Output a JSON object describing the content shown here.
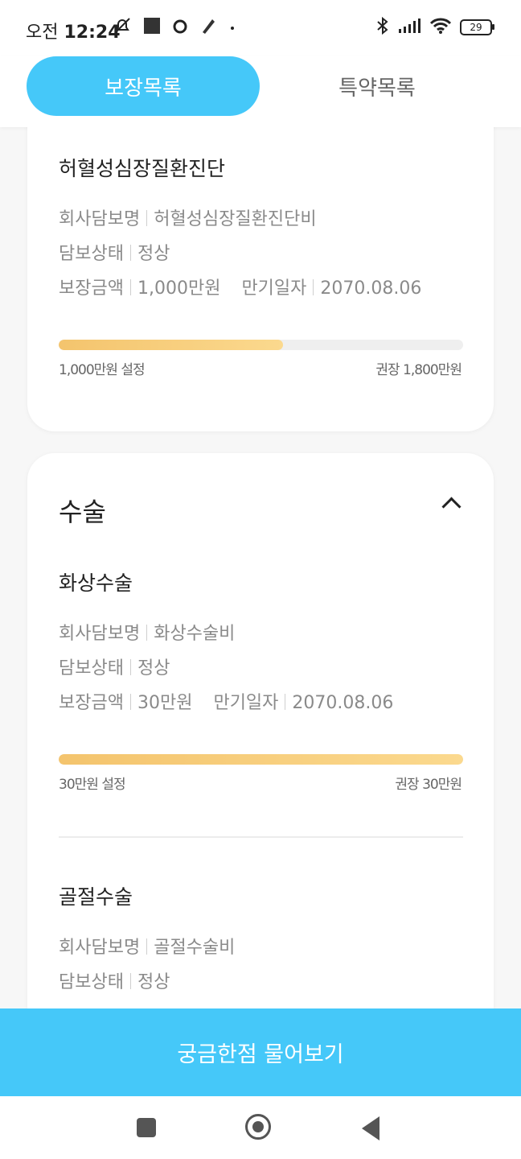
{
  "status_bar": {
    "time_prefix": "오전",
    "time": "12:24",
    "battery": "29",
    "icons_left": [
      "mute-icon",
      "square-icon",
      "circle-icon",
      "pen-icon",
      "dot-icon"
    ],
    "icons_right": [
      "bluetooth-icon",
      "signal-icon",
      "wifi-icon",
      "battery-icon"
    ]
  },
  "tabs": [
    {
      "label": "보장목록",
      "active": true
    },
    {
      "label": "특약목록",
      "active": false
    }
  ],
  "colors": {
    "accent": "#45c8f9",
    "bar_start": "#f4c46d",
    "bar_end": "#fbd98e"
  },
  "coverages": [
    {
      "title": "허혈성심장질환진단",
      "company_label": "회사담보명",
      "company_value": "허혈성심장질환진단비",
      "status_label": "담보상태",
      "status_value": "정상",
      "amount_label": "보장금액",
      "amount_value": "1,000만원",
      "expiry_label": "만기일자",
      "expiry_value": "2070.08.06",
      "bar_left": "1,000만원 설정",
      "bar_right": "권장 1,800만원",
      "bar_ratio": 0.555
    }
  ],
  "surgery_section": {
    "title": "수술",
    "items": [
      {
        "title": "화상수술",
        "company_label": "회사담보명",
        "company_value": "화상수술비",
        "status_label": "담보상태",
        "status_value": "정상",
        "amount_label": "보장금액",
        "amount_value": "30만원",
        "expiry_label": "만기일자",
        "expiry_value": "2070.08.06",
        "bar_left": "30만원 설정",
        "bar_right": "권장 30만원",
        "bar_ratio": 1.0
      },
      {
        "title": "골절수술",
        "company_label": "회사담보명",
        "company_value": "골절수술비",
        "status_label": "담보상태",
        "status_value": "정상"
      }
    ]
  },
  "bottom_button": "궁금한점 물어보기"
}
